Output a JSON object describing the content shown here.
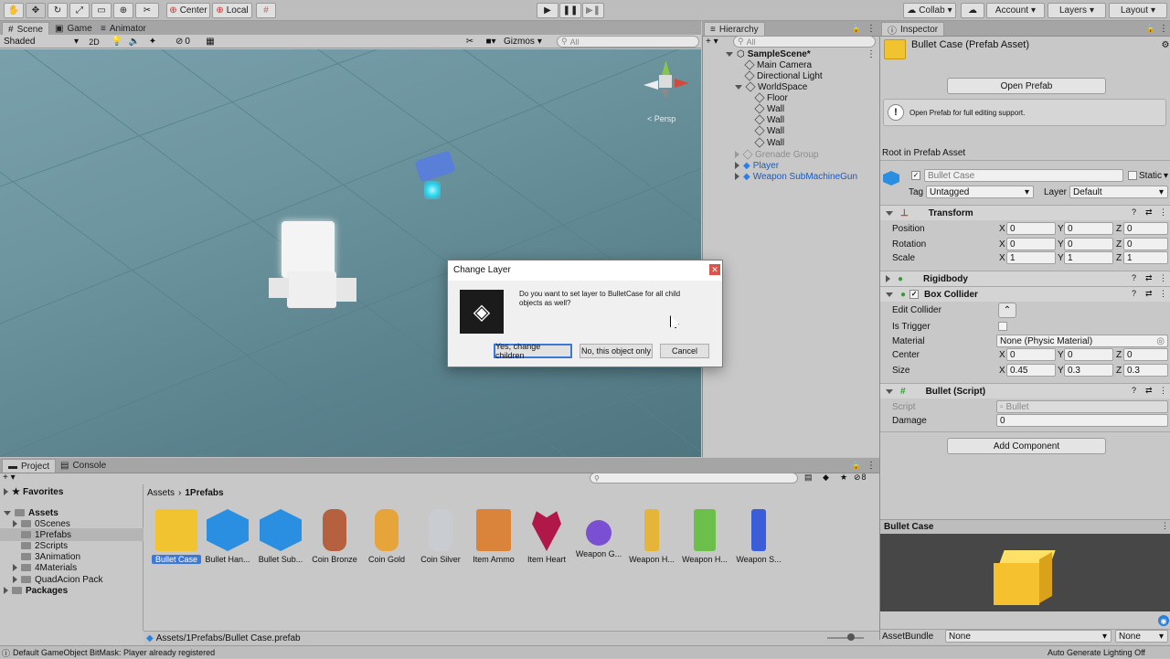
{
  "toolbar": {
    "pivot": "Center",
    "space": "Local",
    "collab": "Collab",
    "account": "Account",
    "layers": "Layers",
    "layout": "Layout"
  },
  "scene": {
    "tabs": [
      "Scene",
      "Game",
      "Animator"
    ],
    "shading": "Shaded",
    "two_d": "2D",
    "fx_count": "0",
    "gizmos": "Gizmos",
    "search_placeholder": "All",
    "persp": "< Persp"
  },
  "hierarchy": {
    "title": "Hierarchy",
    "search_placeholder": "All",
    "items": [
      {
        "label": "SampleScene*"
      },
      {
        "label": "Main Camera"
      },
      {
        "label": "Directional Light"
      },
      {
        "label": "WorldSpace"
      },
      {
        "label": "Floor"
      },
      {
        "label": "Wall"
      },
      {
        "label": "Wall"
      },
      {
        "label": "Wall"
      },
      {
        "label": "Wall"
      },
      {
        "label": "Grenade Group"
      },
      {
        "label": "Player"
      },
      {
        "label": "Weapon SubMachineGun"
      }
    ]
  },
  "inspector": {
    "title": "Inspector",
    "asset_title": "Bullet Case (Prefab Asset)",
    "open_prefab": "Open Prefab",
    "info": "Open Prefab for full editing support.",
    "root_label": "Root in Prefab Asset",
    "object_name": "Bullet Case",
    "static_label": "Static",
    "tag_label": "Tag",
    "tag_value": "Untagged",
    "layer_label": "Layer",
    "layer_value": "Default",
    "transform": {
      "title": "Transform",
      "position_label": "Position",
      "rotation_label": "Rotation",
      "scale_label": "Scale",
      "position": [
        "0",
        "0",
        "0"
      ],
      "rotation": [
        "0",
        "0",
        "0"
      ],
      "scale": [
        "1",
        "1",
        "1"
      ]
    },
    "rigidbody": "Rigidbody",
    "box_collider": {
      "title": "Box Collider",
      "edit_collider": "Edit Collider",
      "is_trigger": "Is Trigger",
      "material_label": "Material",
      "material_value": "None (Physic Material)",
      "center_label": "Center",
      "center": [
        "0",
        "0",
        "0"
      ],
      "size_label": "Size",
      "size": [
        "0.45",
        "0.3",
        "0.3"
      ]
    },
    "bullet_script": {
      "title": "Bullet (Script)",
      "script_label": "Script",
      "script_value": "Bullet",
      "damage_label": "Damage",
      "damage_value": "0"
    },
    "add_component": "Add Component",
    "preview_title": "Bullet Case",
    "assetbundle_label": "AssetBundle",
    "assetbundle_value": "None",
    "assetbundle_variant": "None",
    "axis": {
      "x": "X",
      "y": "Y",
      "z": "Z"
    }
  },
  "project": {
    "tabs": [
      "Project",
      "Console"
    ],
    "favorites": "Favorites",
    "tree": {
      "assets": "Assets",
      "children": [
        "0Scenes",
        "1Prefabs",
        "2Scripts",
        "3Animation",
        "4Materials",
        "QuadAcion Pack"
      ],
      "packages": "Packages"
    },
    "breadcrumb": [
      "Assets",
      "1Prefabs"
    ],
    "hidden_count": "8",
    "assets": [
      {
        "label": "Bullet Case",
        "color": "#f2c330"
      },
      {
        "label": "Bullet Han...",
        "color": "#2a8fe0"
      },
      {
        "label": "Bullet Sub...",
        "color": "#2a8fe0"
      },
      {
        "label": "Coin Bronze",
        "color": "#b5603e"
      },
      {
        "label": "Coin Gold",
        "color": "#e7a43a"
      },
      {
        "label": "Coin Silver",
        "color": "#c9cdd2"
      },
      {
        "label": "Item Ammo",
        "color": "#d9843a"
      },
      {
        "label": "Item Heart",
        "color": "#b0184a"
      },
      {
        "label": "Weapon G...",
        "color": "#7b4fd1"
      },
      {
        "label": "Weapon H...",
        "color": "#e5b53a"
      },
      {
        "label": "Weapon H...",
        "color": "#6cbf4a"
      },
      {
        "label": "Weapon S...",
        "color": "#3b5ed8"
      }
    ],
    "path": "Assets/1Prefabs/Bullet Case.prefab"
  },
  "dialog": {
    "title": "Change Layer",
    "message": "Do you want to set layer to BulletCase for all child objects as well?",
    "yes": "Yes, change children",
    "no": "No, this object only",
    "cancel": "Cancel"
  },
  "status": {
    "message": "Default GameObject BitMask: Player already registered",
    "lighting": "Auto Generate Lighting Off"
  }
}
